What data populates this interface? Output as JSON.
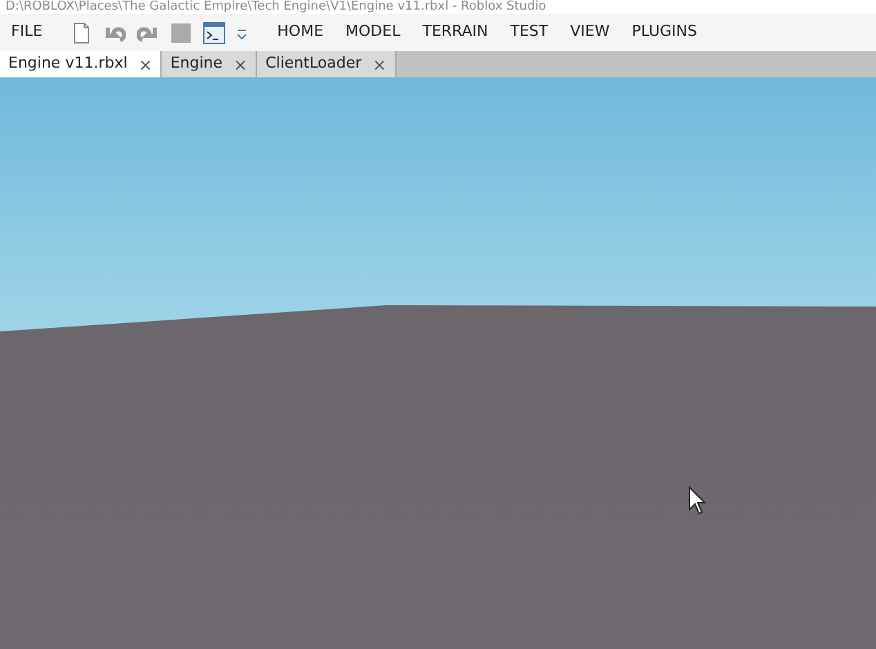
{
  "window": {
    "title": "D:\\ROBLOX\\Places\\The Galactic Empire\\Tech Engine\\V1\\Engine v11.rbxl - Roblox Studio"
  },
  "file_menu": "FILE",
  "ribbon_tabs": [
    "HOME",
    "MODEL",
    "TERRAIN",
    "TEST",
    "VIEW",
    "PLUGINS"
  ],
  "document_tabs": [
    {
      "label": "Engine v11.rbxl",
      "selected": true,
      "close": "×"
    },
    {
      "label": "Engine",
      "selected": false,
      "close": "×"
    },
    {
      "label": "ClientLoader",
      "selected": false,
      "close": "×"
    }
  ]
}
